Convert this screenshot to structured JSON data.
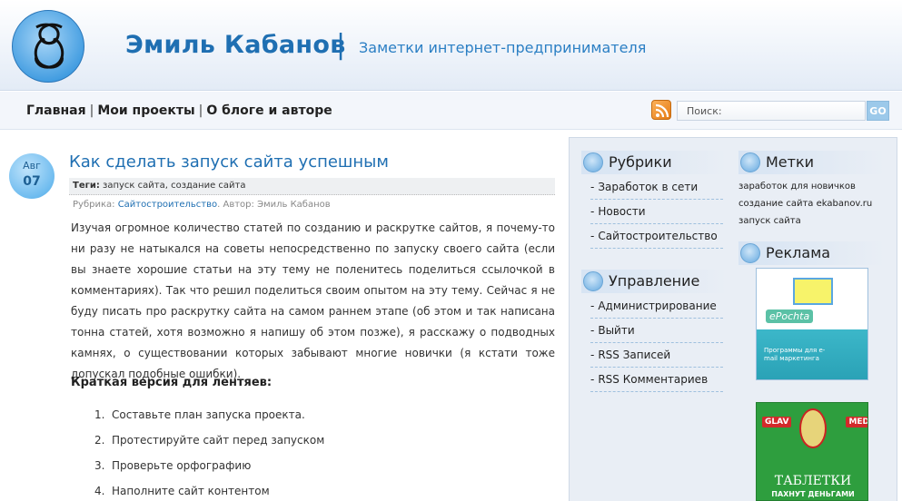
{
  "header": {
    "title": "Эмиль Кабанов",
    "separator": "|",
    "tagline": "Заметки интернет-предпринимателя"
  },
  "nav": {
    "items": [
      "Главная",
      "Мои проекты",
      "О блоге и авторе"
    ],
    "separator": "|"
  },
  "search": {
    "placeholder": "Поиск:",
    "button": "GO"
  },
  "post": {
    "date_month": "Авг",
    "date_day": "07",
    "title": "Как сделать запуск сайта успешным",
    "tags_label": "Теги:",
    "tags": "запуск сайта, создание сайта",
    "rubric_label": "Рубрика:",
    "rubric": "Сайтостроительство",
    "author_label": ". Автор:",
    "author": "Эмиль Кабанов",
    "body": "Изучая огромное количество статей по созданию и раскрутке сайтов, я почему-то ни разу не натыкался на советы непосредственно по запуску своего сайта (если вы знаете хорошие статьи на эту тему не поленитесь поделиться ссылочкой в комментариях). Так что решил поделиться своим опытом на эту тему. Сейчас я не буду писать про раскрутку сайта на самом раннем этапе (об этом и так написана тонна статей, хотя возможно я напишу об этом позже), я расскажу о подводных камнях, о существовании которых забывают многие новички (я кстати тоже допускал подобные ошибки).",
    "subhead": "Краткая версия для лентяев:",
    "list": [
      {
        "num": "1.",
        "text": "Составьте план запуска проекта."
      },
      {
        "num": "2.",
        "text": "Протестируйте сайт перед запуском"
      },
      {
        "num": "3.",
        "text": "Проверьте орфографию"
      },
      {
        "num": "4.",
        "text": "Наполните сайт контентом"
      }
    ]
  },
  "sidebar": {
    "rubrics_title": "Рубрики",
    "rubrics": [
      "Заработок в сети",
      "Новости",
      "Сайтостроительство"
    ],
    "manage_title": "Управление",
    "manage": [
      "Администрирование",
      "Выйти",
      "RSS Записей",
      "RSS Комментариев"
    ],
    "tags_title": "Метки",
    "tags": [
      "заработок для новичков",
      "создание сайта",
      "ekabanov.ru",
      "запуск сайта"
    ],
    "ads_title": "Реклама",
    "ad1": {
      "logo": "ePochta",
      "caption": "Программы для e-mail маркетинга"
    },
    "ad2": {
      "brand1": "GLAV",
      "brand2": "MED",
      "big": "ТАБЛЕТКИ",
      "small": "ПАХНУТ ДЕНЬГАМИ"
    }
  }
}
